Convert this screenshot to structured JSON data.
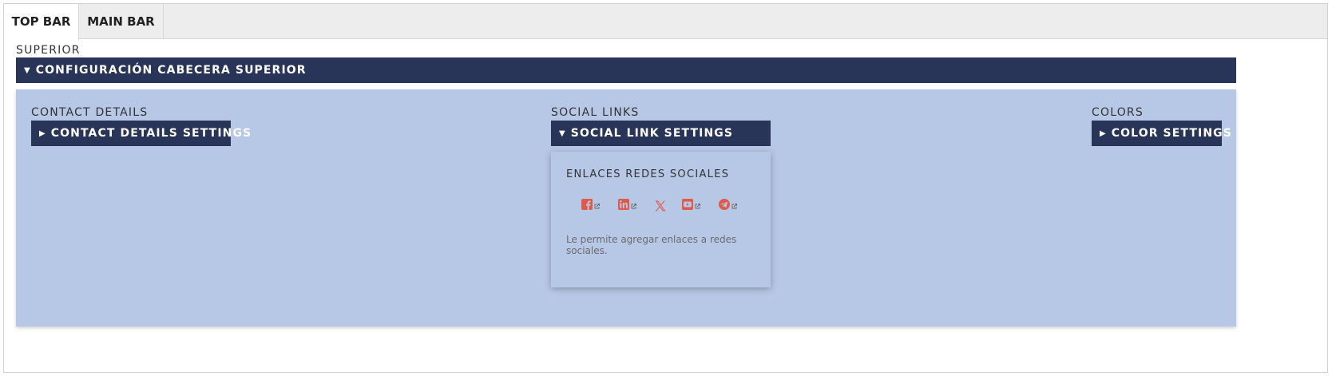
{
  "tabs": [
    {
      "label": "TOP BAR",
      "active": true
    },
    {
      "label": "MAIN BAR",
      "active": false
    }
  ],
  "header": {
    "section_label": "SUPERIOR",
    "toggle_label": "CONFIGURACIÓN CABECERA SUPERIOR",
    "toggle_state": "expanded"
  },
  "columns": {
    "contact": {
      "label": "CONTACT DETAILS",
      "toggle_label": "CONTACT DETAILS SETTINGS",
      "toggle_state": "collapsed"
    },
    "social": {
      "label": "SOCIAL LINKS",
      "toggle_label": "SOCIAL LINK SETTINGS",
      "toggle_state": "expanded"
    },
    "colors": {
      "label": "COLORS",
      "toggle_label": "COLOR SETTINGS",
      "toggle_state": "collapsed"
    }
  },
  "social_card": {
    "title": "ENLACES REDES SOCIALES",
    "description": "Le permite agregar enlaces a redes sociales.",
    "icons": [
      "facebook-icon",
      "linkedin-icon",
      "x-icon",
      "youtube-icon",
      "telegram-icon"
    ],
    "icon_color": "#e05a47"
  },
  "colors": {
    "header_bar": "#283558",
    "panel_bg": "#b7c8e6",
    "tab_bar_bg": "#ededed"
  }
}
